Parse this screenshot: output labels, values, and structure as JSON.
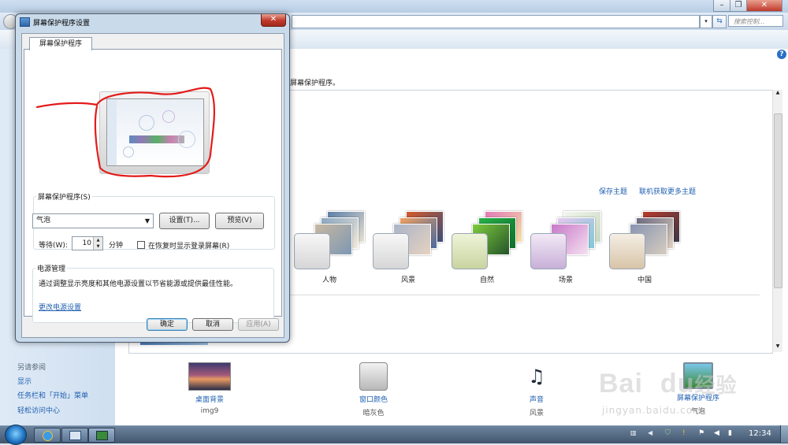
{
  "background_window": {
    "search_placeholder": "搜索控制...",
    "description": "屏幕保护程序。",
    "links": {
      "save_theme": "保存主题",
      "get_more_themes": "联机获取更多主题"
    },
    "themes": [
      {
        "name": "人物"
      },
      {
        "name": "风景"
      },
      {
        "name": "自然"
      },
      {
        "name": "场景"
      },
      {
        "name": "中国"
      }
    ],
    "bottom_items": [
      {
        "title": "桌面背景",
        "value": "img9"
      },
      {
        "title": "窗口颜色",
        "value": "暗灰色"
      },
      {
        "title": "声音",
        "value": "风景"
      },
      {
        "title": "屏幕保护程序",
        "value": "气泡"
      }
    ],
    "see_also": {
      "heading": "另请参阅",
      "items": [
        "显示",
        "任务栏和「开始」菜单",
        "轻松访问中心"
      ]
    }
  },
  "dialog": {
    "title": "屏幕保护程序设置",
    "close_glyph": "✕",
    "tab_label": "屏幕保护程序",
    "screensaver_group": {
      "label": "屏幕保护程序(S)",
      "selected": "气泡",
      "settings_button": "设置(T)...",
      "preview_button": "预览(V)",
      "wait_label": "等待(W):",
      "wait_value": "10",
      "wait_unit": "分钟",
      "resume_checkbox_label": "在恢复时显示登录屏幕(R)",
      "resume_checked": false
    },
    "power_group": {
      "label": "电源管理",
      "description": "通过调整显示亮度和其他电源设置以节省能源或提供最佳性能。",
      "link": "更改电源设置"
    },
    "buttons": {
      "ok": "确定",
      "cancel": "取消",
      "apply": "应用(A)"
    }
  },
  "taskbar": {
    "clock": "12:34"
  },
  "watermark": {
    "brand": "Bai",
    "brand_tail": "du",
    "brand_cn": "经验",
    "url": "jingyan.baidu.com"
  },
  "colors": {
    "link": "#1f5fb0",
    "annotation_red": "#e31b1b",
    "taskbar": "#41556d",
    "close_button": "#c0392b"
  }
}
